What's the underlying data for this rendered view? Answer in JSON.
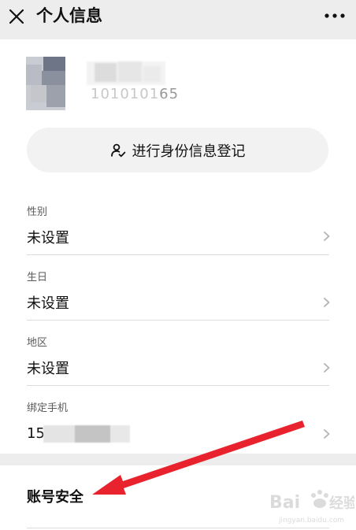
{
  "header": {
    "title": "个人信息",
    "close_icon": "close-icon",
    "more_icon": "more-dots-icon",
    "background": "#ededed"
  },
  "profile": {
    "phone_visible_end": "65",
    "phone_masked_prefix": "1010101",
    "avatar_note": "pixelated avatar"
  },
  "register": {
    "label": "进行身份信息登记",
    "icon": "user-check-icon"
  },
  "fields": [
    {
      "label": "性别",
      "value": "未设置"
    },
    {
      "label": "生日",
      "value": "未设置"
    },
    {
      "label": "地区",
      "value": "未设置"
    },
    {
      "label": "绑定手机",
      "value": "15"
    }
  ],
  "security": {
    "label": "账号安全"
  },
  "annotation": {
    "arrow_color": "#e8232e"
  },
  "watermark": {
    "text": "Bai 经验",
    "url": "jingyan.baidu.com"
  }
}
